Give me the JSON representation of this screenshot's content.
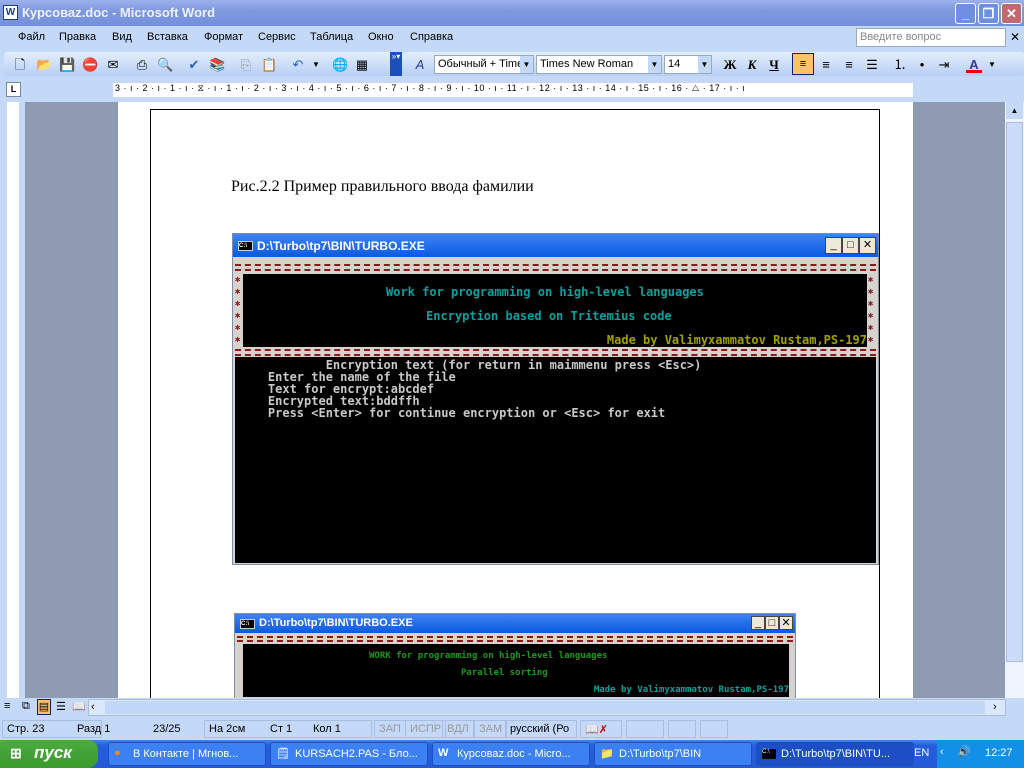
{
  "window": {
    "title": "Курсоваz.doc - Microsoft Word"
  },
  "menu": [
    "Файл",
    "Правка",
    "Вид",
    "Вставка",
    "Формат",
    "Сервис",
    "Таблица",
    "Окно",
    "Справка"
  ],
  "ask_placeholder": "Введите вопрос",
  "format": {
    "style": "Обычный + Time",
    "font": "Times New Roman",
    "size": "14",
    "bold": "Ж",
    "italic": "К",
    "underline": "Ч",
    "font_color": "А"
  },
  "ruler_text": "3 · ı · 2 · ı · 1 · ı · ⧖ · ı · 1 · ı · 2 · ı · 3 · ı · 4 · ı · 5 · ı · 6 · ı · 7 · ı · 8 · ı · 9 · ı · 10 · ı · 11 · ı · 12 · ı · 13 · ı · 14 · ı · 15 · ı · 16 · △ · 17 · ı · ı",
  "document": {
    "caption": "Рис.2.2 Пример правильного ввода фамилии"
  },
  "console1": {
    "title": "D:\\Turbo\\tp7\\BIN\\TURBO.EXE",
    "header1": "Work for programming on high-level languages",
    "header2": "Encryption based on Tritemius code",
    "author": "Made by Valimyxammatov Rustam,PS-197",
    "lines": [
      "            Encryption text (for return in maimmenu press <Esc>)",
      "    Enter the name of the file",
      "    Text for encrypt:abcdef",
      "    Encrypted text:bddffh",
      "    Press <Enter> for continue encryption or <Esc> for exit"
    ]
  },
  "console2": {
    "title": "D:\\Turbo\\tp7\\BIN\\TURBO.EXE",
    "header1": "WORK for programming on high-level languages",
    "header2": "Parallel sorting",
    "author": "Made by Valimyxammatov Rustam,PS-197"
  },
  "status": {
    "page": "Стр. 23",
    "section": "Разд 1",
    "pages": "23/25",
    "at": "На 2см",
    "line": "Ст 1",
    "col": "Кол 1",
    "rec": "ЗАП",
    "trk": "ИСПР",
    "ext": "ВДЛ",
    "ovr": "ЗАМ",
    "lang": "русский (Ро"
  },
  "taskbar": {
    "start": "пуск",
    "tasks": [
      "В Контакте | Мгнов...",
      "KURSACH2.PAS - Бло...",
      "Курсоваz.doc - Micro...",
      "D:\\Turbo\\tp7\\BIN",
      "D:\\Turbo\\tp7\\BIN\\TU..."
    ],
    "lang": "EN",
    "clock": "12:27"
  }
}
